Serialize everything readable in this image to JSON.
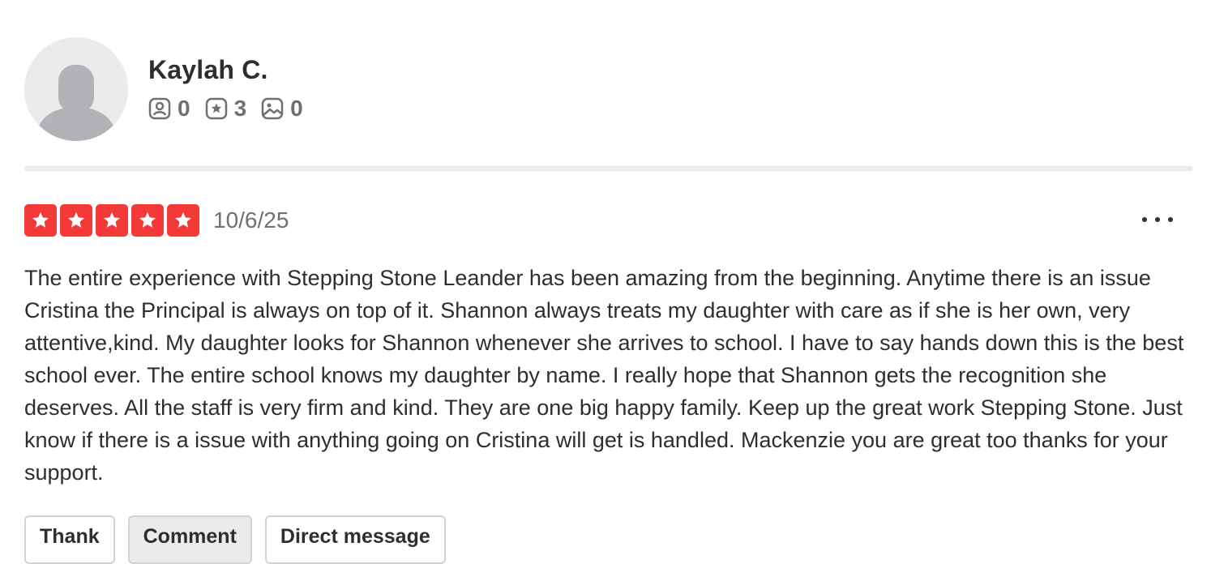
{
  "user": {
    "name": "Kaylah C.",
    "stats": [
      {
        "icon": "friends-icon",
        "count": "0"
      },
      {
        "icon": "reviews-icon",
        "count": "3"
      },
      {
        "icon": "photos-icon",
        "count": "0"
      }
    ]
  },
  "review": {
    "rating": 5,
    "rating_max": 5,
    "date": "10/6/25",
    "text": "The entire experience with Stepping Stone Leander has been amazing from the beginning. Anytime there is an issue Cristina the Principal is always on top of it. Shannon always treats my daughter with care as if she is her own, very attentive,kind. My daughter looks for Shannon whenever she arrives to school. I have to say hands down this is the best school ever. The entire school knows my daughter by name. I really hope that Shannon gets the recognition she deserves. All the staff is very firm and kind. They are one big happy family. Keep up the great work Stepping Stone. Just know if there is a issue with anything going on Cristina will get is handled. Mackenzie you are great too thanks for your support."
  },
  "actions": {
    "thank_label": "Thank",
    "comment_label": "Comment",
    "direct_message_label": "Direct message"
  },
  "colors": {
    "star_fill": "#f43939",
    "text": "#2d2e2f",
    "muted": "#6e7072",
    "avatar_bg": "#ebebeb"
  }
}
